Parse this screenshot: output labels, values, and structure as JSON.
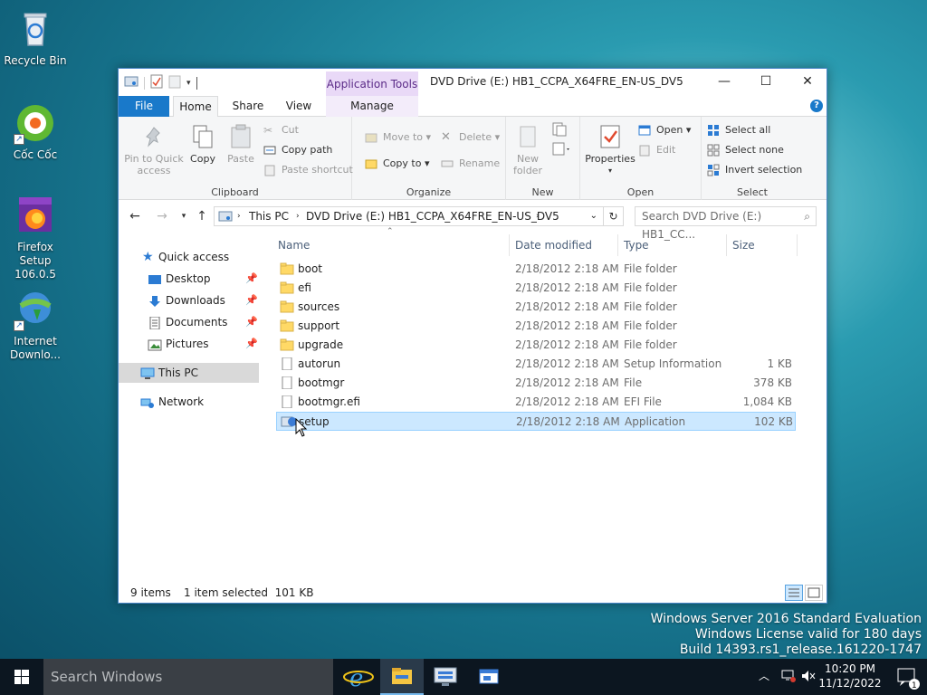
{
  "desktop": {
    "icons": [
      {
        "label": "Recycle Bin",
        "icon": "recycle-bin-icon"
      },
      {
        "label": "Cốc Cốc",
        "icon": "coccoc-browser-icon"
      },
      {
        "label": "Firefox Setup 106.0.5",
        "icon": "firefox-installer-icon"
      },
      {
        "label": "Internet Downlo...",
        "icon": "internet-download-manager-icon"
      }
    ]
  },
  "window": {
    "title": "DVD Drive (E:) HB1_CCPA_X64FRE_EN-US_DV5",
    "context_tab_header": "Application Tools",
    "controls": {
      "minimize": "—",
      "maximize": "☐",
      "close": "✕"
    },
    "tabs": {
      "file": "File",
      "home": "Home",
      "share": "Share",
      "view": "View",
      "manage": "Manage"
    },
    "help": "?"
  },
  "ribbon": {
    "clipboard": {
      "label": "Clipboard",
      "pin": "Pin to Quick access",
      "copy": "Copy",
      "paste": "Paste",
      "cut": "Cut",
      "copy_path": "Copy path",
      "paste_shortcut": "Paste shortcut"
    },
    "organize": {
      "label": "Organize",
      "move_to": "Move to",
      "copy_to": "Copy to",
      "delete": "Delete",
      "rename": "Rename"
    },
    "new": {
      "label": "New",
      "new_folder": "New folder"
    },
    "open": {
      "label": "Open",
      "properties": "Properties",
      "open": "Open",
      "edit": "Edit"
    },
    "select": {
      "label": "Select",
      "select_all": "Select all",
      "select_none": "Select none",
      "invert": "Invert selection"
    }
  },
  "address": {
    "breadcrumb": [
      "This PC",
      "DVD Drive (E:) HB1_CCPA_X64FRE_EN-US_DV5"
    ],
    "search_placeholder": "Search DVD Drive (E:) HB1_CC..."
  },
  "nav": {
    "quick_access": "Quick access",
    "items": [
      {
        "label": "Desktop",
        "pinned": true
      },
      {
        "label": "Downloads",
        "pinned": true
      },
      {
        "label": "Documents",
        "pinned": true
      },
      {
        "label": "Pictures",
        "pinned": true
      }
    ],
    "this_pc": "This PC",
    "network": "Network"
  },
  "files": {
    "columns": {
      "name": "Name",
      "date": "Date modified",
      "type": "Type",
      "size": "Size"
    },
    "rows": [
      {
        "name": "boot",
        "date": "2/18/2012 2:18 AM",
        "type": "File folder",
        "size": "",
        "kind": "folder"
      },
      {
        "name": "efi",
        "date": "2/18/2012 2:18 AM",
        "type": "File folder",
        "size": "",
        "kind": "folder"
      },
      {
        "name": "sources",
        "date": "2/18/2012 2:18 AM",
        "type": "File folder",
        "size": "",
        "kind": "folder"
      },
      {
        "name": "support",
        "date": "2/18/2012 2:18 AM",
        "type": "File folder",
        "size": "",
        "kind": "folder"
      },
      {
        "name": "upgrade",
        "date": "2/18/2012 2:18 AM",
        "type": "File folder",
        "size": "",
        "kind": "folder"
      },
      {
        "name": "autorun",
        "date": "2/18/2012 2:18 AM",
        "type": "Setup Information",
        "size": "1 KB",
        "kind": "file"
      },
      {
        "name": "bootmgr",
        "date": "2/18/2012 2:18 AM",
        "type": "File",
        "size": "378 KB",
        "kind": "file"
      },
      {
        "name": "bootmgr.efi",
        "date": "2/18/2012 2:18 AM",
        "type": "EFI File",
        "size": "1,084 KB",
        "kind": "file"
      },
      {
        "name": "setup",
        "date": "2/18/2012 2:18 AM",
        "type": "Application",
        "size": "102 KB",
        "kind": "app",
        "selected": true
      }
    ]
  },
  "status": {
    "count": "9 items",
    "selection": "1 item selected  101 KB"
  },
  "watermark": {
    "line1": "Windows Server 2016 Standard Evaluation",
    "line2": "Windows License valid for 180 days",
    "line3": "Build 14393.rs1_release.161220-1747"
  },
  "taskbar": {
    "search_placeholder": "Search Windows",
    "time": "10:20 PM",
    "date": "11/12/2022"
  },
  "colors": {
    "accent": "#1979ca",
    "selection": "#cce8ff",
    "context_tab": "#e9d9f7"
  }
}
